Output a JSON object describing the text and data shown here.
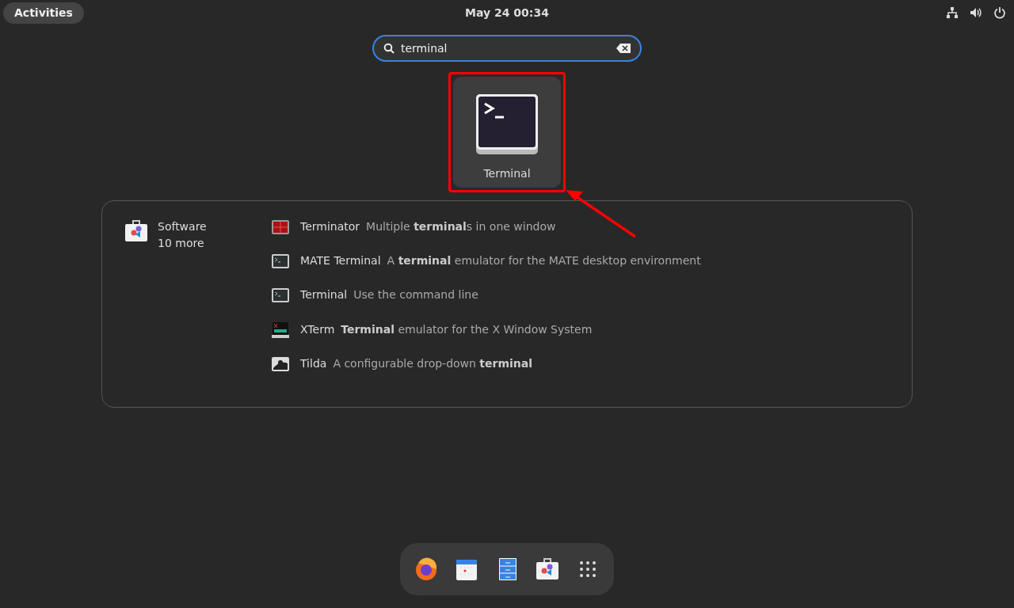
{
  "top_bar": {
    "activities": "Activities",
    "clock": "May 24  00:34"
  },
  "search": {
    "value": "terminal"
  },
  "top_result": {
    "label": "Terminal",
    "selected": true
  },
  "provider": {
    "name": "Software",
    "more": "10 more"
  },
  "results": [
    {
      "kind": "terminator",
      "name": "Terminator",
      "description": "Multiple **terminal**s in one window"
    },
    {
      "kind": "console",
      "name": "MATE Terminal",
      "description": "A **terminal** emulator for the MATE desktop environment"
    },
    {
      "kind": "console",
      "name": "Terminal",
      "description": "Use the command line"
    },
    {
      "kind": "xterm",
      "name": "XTerm",
      "description": "**Terminal** emulator for the X Window System"
    },
    {
      "kind": "tilda",
      "name": "Tilda",
      "description": "A configurable drop-down **terminal**"
    }
  ],
  "dock": [
    {
      "kind": "browser"
    },
    {
      "kind": "calendar"
    },
    {
      "kind": "files"
    },
    {
      "kind": "store"
    },
    {
      "kind": "apps"
    }
  ]
}
